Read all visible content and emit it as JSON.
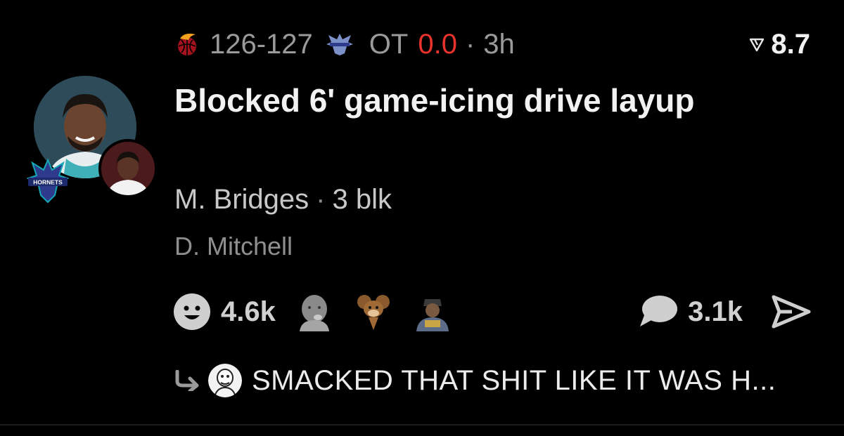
{
  "score": {
    "value": "126-127",
    "period": "OT",
    "clock": "0.0",
    "separator": "·",
    "age": "3h"
  },
  "rating": {
    "value": "8.7",
    "icon": "rating-icon"
  },
  "play": {
    "title": "Blocked 6' game-icing drive layup"
  },
  "player": {
    "name": "M. Bridges",
    "separator": "·",
    "stat": "3 blk"
  },
  "defender": {
    "name": "D. Mitchell"
  },
  "team_logo_text": "HORNETS",
  "reactions": {
    "icon": "smiley-icon",
    "count": "4.6k"
  },
  "comments": {
    "icon": "comment-bubble-icon",
    "count": "3.1k"
  },
  "reply": {
    "icon": "reply-arrow-icon",
    "text": "SMACKED THAT SHIT LIKE IT WAS H..."
  },
  "colors": {
    "background": "#000000",
    "accent_red": "#e8322c",
    "muted": "#9a9a9a",
    "text": "#f2f2f2"
  }
}
